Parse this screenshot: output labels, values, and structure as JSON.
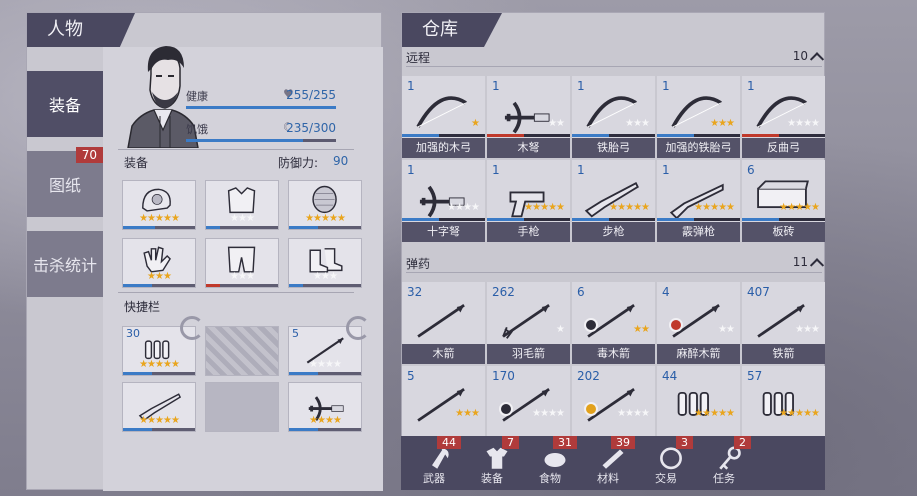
{
  "character_panel": {
    "title": "人物",
    "tabs": [
      {
        "label": "装备",
        "badge": null,
        "active": true
      },
      {
        "label": "图纸",
        "badge": "70",
        "active": false
      },
      {
        "label": "击杀统计",
        "badge": null,
        "active": false
      }
    ],
    "stats": {
      "health": {
        "label": "健康",
        "value": "255/255",
        "fill": 1.0
      },
      "hunger": {
        "label": "饥饿",
        "value": "235/300",
        "fill": 0.78
      }
    },
    "equipment_label": "装备",
    "defense_label": "防御力:",
    "defense_value": "90",
    "quickbar_label": "快捷栏",
    "equipment_slots": [
      {
        "icon": "helmet-icon",
        "stars": 5,
        "gold": 5,
        "bar_color": "#3b7bc6",
        "bar_fill": 0.45
      },
      {
        "icon": "vest-icon",
        "stars": 3,
        "gold": 0,
        "bar_color": "#3b7bc6",
        "bar_fill": 0.2
      },
      {
        "icon": "armor-icon",
        "stars": 5,
        "gold": 5,
        "bar_color": "#3b7bc6",
        "bar_fill": 0.4
      },
      {
        "icon": "gloves-icon",
        "stars": 3,
        "gold": 3,
        "bar_color": "#3b7bc6",
        "bar_fill": 0.4
      },
      {
        "icon": "pants-icon",
        "stars": 3,
        "gold": 0,
        "bar_color": "#c0392b",
        "bar_fill": 0.2
      },
      {
        "icon": "boots-icon",
        "stars": 3,
        "gold": 0,
        "bar_color": "#3b7bc6",
        "bar_fill": 0.2
      }
    ],
    "quick_slots": [
      {
        "count": "30",
        "icon": "bullets-icon",
        "stars": 5,
        "gold": 5,
        "type": "item"
      },
      {
        "count": "",
        "icon": "lock-icon",
        "stars": 0,
        "gold": 0,
        "type": "locked"
      },
      {
        "count": "5",
        "icon": "arrow-icon",
        "stars": 4,
        "gold": 0,
        "type": "item"
      },
      {
        "count": "",
        "icon": "rifle-icon",
        "stars": 5,
        "gold": 5,
        "type": "item"
      },
      {
        "count": "",
        "icon": "empty-icon",
        "stars": 0,
        "gold": 0,
        "type": "empty"
      },
      {
        "count": "",
        "icon": "crossbow-icon",
        "stars": 4,
        "gold": 4,
        "type": "item"
      }
    ]
  },
  "storage_panel": {
    "title": "仓库",
    "categories": [
      {
        "label": "远程",
        "count": "10",
        "items": [
          {
            "qty": "1",
            "name": "加强的木弓",
            "icon": "bow-icon",
            "stars": 1,
            "gold": 1,
            "bar_color": "#3b7bc6"
          },
          {
            "qty": "1",
            "name": "木弩",
            "icon": "crossbow-icon",
            "stars": 2,
            "gold": 0,
            "bar_color": "#c0392b"
          },
          {
            "qty": "1",
            "name": "铁胎弓",
            "icon": "bow-icon",
            "stars": 3,
            "gold": 0,
            "bar_color": "#3b7bc6"
          },
          {
            "qty": "1",
            "name": "加强的铁胎弓",
            "icon": "bow-icon",
            "stars": 3,
            "gold": 3,
            "bar_color": "#3b7bc6"
          },
          {
            "qty": "1",
            "name": "反曲弓",
            "icon": "bow-icon",
            "stars": 4,
            "gold": 0,
            "bar_color": "#c0392b"
          },
          {
            "qty": "1",
            "name": "十字弩",
            "icon": "crossbow-icon",
            "stars": 4,
            "gold": 0,
            "bar_color": "#3b7bc6"
          },
          {
            "qty": "1",
            "name": "手枪",
            "icon": "pistol-icon",
            "stars": 5,
            "gold": 5,
            "bar_color": "#3b7bc6"
          },
          {
            "qty": "1",
            "name": "步枪",
            "icon": "rifle-icon",
            "stars": 5,
            "gold": 5,
            "bar_color": "#3b7bc6"
          },
          {
            "qty": "1",
            "name": "霰弹枪",
            "icon": "shotgun-icon",
            "stars": 5,
            "gold": 5,
            "bar_color": "#3b7bc6"
          },
          {
            "qty": "6",
            "name": "板砖",
            "icon": "brick-icon",
            "stars": 5,
            "gold": 5,
            "bar_color": "#3b7bc6"
          }
        ]
      },
      {
        "label": "弹药",
        "count": "11",
        "items": [
          {
            "qty": "32",
            "name": "木箭",
            "icon": "arrow-icon",
            "stars": 0,
            "gold": 0,
            "badge": null
          },
          {
            "qty": "262",
            "name": "羽毛箭",
            "icon": "feather-arrow-icon",
            "stars": 1,
            "gold": 0,
            "badge": null
          },
          {
            "qty": "6",
            "name": "毒木箭",
            "icon": "arrow-icon",
            "stars": 2,
            "gold": 2,
            "badge": "poison-icon"
          },
          {
            "qty": "4",
            "name": "麻醉木箭",
            "icon": "arrow-icon",
            "stars": 2,
            "gold": 0,
            "badge": "tranq-icon"
          },
          {
            "qty": "407",
            "name": "铁箭",
            "icon": "arrow-icon",
            "stars": 3,
            "gold": 0,
            "badge": null
          },
          {
            "qty": "5",
            "name": "",
            "icon": "arrow-icon",
            "stars": 3,
            "gold": 3,
            "badge": null
          },
          {
            "qty": "170",
            "name": "",
            "icon": "arrow-icon",
            "stars": 4,
            "gold": 0,
            "badge": "poison-icon"
          },
          {
            "qty": "202",
            "name": "",
            "icon": "arrow-icon",
            "stars": 4,
            "gold": 0,
            "badge": "fire-icon"
          },
          {
            "qty": "44",
            "name": "",
            "icon": "bullets-icon",
            "stars": 5,
            "gold": 5,
            "badge": null
          },
          {
            "qty": "57",
            "name": "",
            "icon": "bullets-icon",
            "stars": 5,
            "gold": 5,
            "badge": null
          }
        ]
      }
    ],
    "bottom_tabs": [
      {
        "label": "武器",
        "badge": "44",
        "icon": "axe-icon"
      },
      {
        "label": "装备",
        "badge": "7",
        "icon": "shirt-icon"
      },
      {
        "label": "食物",
        "badge": "31",
        "icon": "food-icon"
      },
      {
        "label": "材料",
        "badge": "39",
        "icon": "material-icon"
      },
      {
        "label": "交易",
        "badge": "3",
        "icon": "trade-icon"
      },
      {
        "label": "任务",
        "badge": "2",
        "icon": "key-icon"
      }
    ]
  }
}
